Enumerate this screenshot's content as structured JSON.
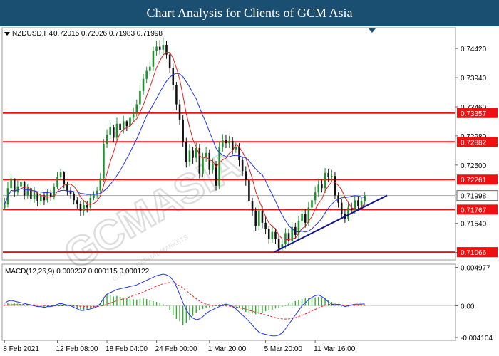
{
  "header": {
    "title": "Chart Analysis for Clients of GCM Asia"
  },
  "symbol_info": {
    "symbol": "NZDUSD,H4",
    "ohlc": "0.72015 0.72026 0.71983 0.71998"
  },
  "macd_info": {
    "label": "MACD(12,26,9) 0.000237 0.000115 0.000122"
  },
  "watermark": {
    "text": "GCMASIA",
    "subtext": "GLOBAL CAPITAL MARKETS"
  },
  "colors": {
    "resistance": "#ee1111",
    "trendline": "#111199",
    "ma_fast": "#dd2222",
    "ma_slow": "#2233ee",
    "bull": "#1d8f2c",
    "bear": "#111111",
    "current_price_bg": "#ffffff",
    "level_label_bg": "#ee1111",
    "macd_hist": "#33aa33",
    "macd_signal": "#ee2222",
    "macd_line": "#2233ee"
  },
  "chart_data": [
    {
      "type": "line",
      "title": "NZDUSD,H4",
      "ylim": [
        0.7095,
        0.7475
      ],
      "price_ticks": [
        "0.74420",
        "0.73940",
        "0.73460",
        "0.72980",
        "0.72500",
        "0.72020",
        "0.71540",
        "0.71060"
      ],
      "price_tick_values": [
        0.7442,
        0.7394,
        0.7346,
        0.7298,
        0.725,
        0.7202,
        0.7154,
        0.7106
      ],
      "x_labels": [
        "8 Feb 2021",
        "12 Feb 08:00",
        "18 Feb 04:00",
        "24 Feb 00:00",
        "1 Mar 20:00",
        "5 Mar 20:00",
        "11 Mar 16:00"
      ],
      "levels": [
        {
          "label": "0.73357",
          "value": 0.73357
        },
        {
          "label": "0.72882",
          "value": 0.72882
        },
        {
          "label": "0.72261",
          "value": 0.72261
        },
        {
          "label": "0.71767",
          "value": 0.71767
        },
        {
          "label": "0.71066",
          "value": 0.71066
        }
      ],
      "current_price": {
        "label": "0.71998",
        "value": 0.71998
      },
      "trendline": {
        "from": [
          0.0,
          0.7107
        ],
        "to": [
          1.0,
          0.72
        ]
      },
      "series": [
        {
          "close": [
            0.7185,
            0.7212,
            0.7228,
            0.7205,
            0.7215,
            0.7222,
            0.72,
            0.7212,
            0.7194,
            0.7205,
            0.719,
            0.72,
            0.7192,
            0.7204,
            0.7197,
            0.7214,
            0.723,
            0.7238,
            0.7219,
            0.7208,
            0.7203,
            0.7192,
            0.7186,
            0.7174,
            0.7184,
            0.718,
            0.7196,
            0.7201,
            0.7208,
            0.7228,
            0.7285,
            0.73,
            0.7312,
            0.7295,
            0.7318,
            0.7308,
            0.7322,
            0.7314,
            0.7328,
            0.7336,
            0.735,
            0.7372,
            0.7392,
            0.7405,
            0.7412,
            0.7438,
            0.7445,
            0.744,
            0.7448,
            0.7432,
            0.741,
            0.7382,
            0.735,
            0.7325,
            0.7288,
            0.7255,
            0.7274,
            0.7262,
            0.7278,
            0.7236,
            0.7262,
            0.727,
            0.7242,
            0.7252,
            0.7216,
            0.728,
            0.7292,
            0.7286,
            0.729,
            0.7276,
            0.728,
            0.7258,
            0.724,
            0.7225,
            0.719,
            0.7175,
            0.715,
            0.7175,
            0.7155,
            0.7145,
            0.7128,
            0.714,
            0.7128,
            0.7112,
            0.712,
            0.7138,
            0.7125,
            0.7148,
            0.7135,
            0.7158,
            0.717,
            0.7155,
            0.718,
            0.7192,
            0.7205,
            0.7218,
            0.7212,
            0.7237,
            0.723,
            0.7232,
            0.72,
            0.7188,
            0.717,
            0.7162,
            0.718,
            0.7176,
            0.7192,
            0.7182,
            0.719,
            0.72
          ],
          "name": "",
          "high": [
            0.7196,
            0.7222,
            0.7236,
            0.7226,
            0.7225,
            0.723,
            0.7224,
            0.7218,
            0.7214,
            0.7214,
            0.7205,
            0.7207,
            0.7205,
            0.721,
            0.7209,
            0.722,
            0.7239,
            0.7244,
            0.724,
            0.7223,
            0.7214,
            0.7207,
            0.7197,
            0.719,
            0.7192,
            0.719,
            0.7202,
            0.7207,
            0.7214,
            0.7237,
            0.7293,
            0.7309,
            0.732,
            0.7316,
            0.7328,
            0.7322,
            0.7331,
            0.7324,
            0.7334,
            0.7345,
            0.7358,
            0.7382,
            0.74,
            0.7412,
            0.742,
            0.7445,
            0.7455,
            0.7456,
            0.746,
            0.7455,
            0.7436,
            0.7417,
            0.7387,
            0.7358,
            0.7332,
            0.7295,
            0.7285,
            0.728,
            0.7287,
            0.7285,
            0.727,
            0.728,
            0.7276,
            0.7261,
            0.7257,
            0.7288,
            0.7301,
            0.73,
            0.7298,
            0.7296,
            0.7287,
            0.7286,
            0.7264,
            0.7248,
            0.7232,
            0.7196,
            0.718,
            0.7184,
            0.7183,
            0.7166,
            0.715,
            0.7151,
            0.7146,
            0.7135,
            0.7128,
            0.7146,
            0.7145,
            0.7156,
            0.7155,
            0.7166,
            0.718,
            0.7178,
            0.7189,
            0.72,
            0.7215,
            0.7228,
            0.7225,
            0.7245,
            0.7244,
            0.7242,
            0.7238,
            0.7205,
            0.7194,
            0.7178,
            0.7188,
            0.7188,
            0.72,
            0.7199,
            0.7197,
            0.7206
          ],
          "low": [
            0.7176,
            0.718,
            0.7205,
            0.7198,
            0.72,
            0.721,
            0.7193,
            0.7195,
            0.7186,
            0.7188,
            0.7182,
            0.7184,
            0.7184,
            0.7188,
            0.719,
            0.7193,
            0.721,
            0.7225,
            0.7212,
            0.72,
            0.7195,
            0.7185,
            0.7178,
            0.7166,
            0.7167,
            0.7172,
            0.7174,
            0.7192,
            0.7195,
            0.7202,
            0.7222,
            0.7278,
            0.7293,
            0.7287,
            0.7289,
            0.73,
            0.7302,
            0.7306,
            0.7308,
            0.7322,
            0.733,
            0.7344,
            0.7366,
            0.7385,
            0.7398,
            0.7405,
            0.743,
            0.7432,
            0.7432,
            0.7425,
            0.7402,
            0.7374,
            0.734,
            0.7316,
            0.728,
            0.7246,
            0.7248,
            0.7252,
            0.7255,
            0.7228,
            0.723,
            0.7255,
            0.7234,
            0.7236,
            0.7208,
            0.721,
            0.7272,
            0.7278,
            0.7278,
            0.7268,
            0.727,
            0.7248,
            0.7232,
            0.7216,
            0.7182,
            0.7166,
            0.7142,
            0.7143,
            0.7146,
            0.7136,
            0.712,
            0.7122,
            0.712,
            0.7104,
            0.7107,
            0.7112,
            0.7118,
            0.7118,
            0.7128,
            0.7128,
            0.715,
            0.7147,
            0.715,
            0.7174,
            0.7185,
            0.7198,
            0.7205,
            0.7204,
            0.7222,
            0.7222,
            0.7194,
            0.718,
            0.7162,
            0.7155,
            0.7158,
            0.717,
            0.717,
            0.7178,
            0.718,
            0.7183
          ]
        }
      ]
    },
    {
      "type": "line",
      "title": "MACD(12,26,9)",
      "ylim": [
        -0.00438,
        0.0053
      ],
      "ticks": [
        "0.004977",
        "0.00",
        "-0.004104"
      ],
      "tick_values": [
        0.004977,
        0.0,
        -0.004104
      ],
      "series": [
        {
          "name": "",
          "role": "hist",
          "values": [
            8e-05,
            0.00035,
            0.0004,
            0.0003,
            0.00028,
            0.00022,
            0.00015,
            0.0001,
            2e-05,
            -5e-05,
            -0.0001,
            -0.00012,
            -0.00018,
            -0.00014,
            -0.0001,
            -4e-05,
            0.00012,
            0.0003,
            0.00022,
            0.00012,
            5e-05,
            -0.0001,
            -0.0003,
            -0.0005,
            -0.00055,
            -0.00045,
            -0.00035,
            -0.00025,
            -8e-05,
            0.00035,
            0.0011,
            0.0015,
            0.0014,
            0.0012,
            0.00128,
            0.00115,
            0.00108,
            0.00098,
            0.0009,
            0.00085,
            0.0008,
            0.0009,
            0.00095,
            0.00088,
            0.0007,
            0.0006,
            0.0005,
            0.00038,
            0.00022,
            5e-05,
            -0.0006,
            -0.0012,
            -0.0017,
            -0.002,
            -0.0025,
            -0.0022,
            -0.00185,
            -0.0013,
            -0.0009,
            -0.0006,
            -0.0004,
            -0.0003,
            -0.0002,
            -0.0001,
            2e-05,
            0.00018,
            0.0002,
            0.00025,
            0.00015,
            5e-05,
            -0.0001,
            -0.0003,
            -0.0005,
            -0.0008,
            -0.00095,
            -0.001,
            -0.0011,
            -0.00105,
            -0.0009,
            -0.0007,
            -0.0006,
            -0.0005,
            -0.00035,
            -0.0003,
            -0.00015,
            0.0001,
            0.0003,
            0.00045,
            0.0006,
            0.00075,
            0.0009,
            0.00095,
            0.001,
            0.00105,
            0.0011,
            0.00115,
            0.00108,
            0.00095,
            0.0007,
            0.0005,
            0.0003,
            0.00015,
            -0.0001,
            -0.00015,
            -0.0001,
            0.0,
            5e-05,
            8e-05,
            0.0001,
            0.00012
          ]
        },
        {
          "name": "",
          "role": "signal",
          "values": [
            0.0001,
            0.00012,
            0.00014,
            0.00015,
            0.00016,
            0.00017,
            0.00017,
            0.00016,
            0.00014,
            0.00012,
            0.0001,
            8e-05,
            5e-05,
            3e-05,
            1e-05,
            -1e-05,
            -2e-05,
            -1e-05,
            1e-05,
            2e-05,
            2e-05,
            1e-05,
            -2e-05,
            -6e-05,
            -0.0001,
            -0.00012,
            -0.00013,
            -0.00012,
            -0.0001,
            -5e-05,
            5e-05,
            0.0002,
            0.00035,
            0.0005,
            0.00065,
            0.00078,
            0.00092,
            0.00105,
            0.00118,
            0.0013,
            0.00145,
            0.0016,
            0.00178,
            0.00195,
            0.00215,
            0.00235,
            0.00255,
            0.0027,
            0.00285,
            0.00295,
            0.003,
            0.00295,
            0.0028,
            0.00258,
            0.0023,
            0.00195,
            0.0016,
            0.00125,
            0.00092,
            0.00062,
            0.00038,
            0.00022,
            0.00012,
            6e-05,
            3e-05,
            1e-05,
            0.0,
            -2e-05,
            -5e-05,
            -0.0001,
            -0.00016,
            -0.00024,
            -0.00034,
            -0.00046,
            -0.00058,
            -0.0007,
            -0.00082,
            -0.00094,
            -0.00106,
            -0.00118,
            -0.0013,
            -0.00142,
            -0.00154,
            -0.00164,
            -0.0017,
            -0.00172,
            -0.0017,
            -0.00164,
            -0.00154,
            -0.0014,
            -0.00124,
            -0.00106,
            -0.00086,
            -0.00066,
            -0.00046,
            -0.00026,
            -8e-05,
            6e-05,
            0.00016,
            0.0002,
            0.0002,
            0.00017,
            0.00012,
            8e-05,
            6e-05,
            6e-05,
            8e-05,
            0.0001,
            0.00011,
            0.000115
          ]
        },
        {
          "name": "",
          "role": "macd",
          "values": [
            0.0003,
            0.0006,
            0.0007,
            0.0006,
            0.0005,
            0.0004,
            0.0003,
            0.0002,
            0.0001,
            0.0,
            -0.0001,
            -0.0001,
            -0.0002,
            -0.0001,
            -0.0001,
            0.0,
            0.0002,
            0.0003,
            0.0002,
            0.0001,
            0.0,
            -0.0002,
            -0.0004,
            -0.0006,
            -0.0006,
            -0.0005,
            -0.0004,
            -0.0003,
            -0.0001,
            0.0003,
            0.001,
            0.0015,
            0.0017,
            0.0019,
            0.0021,
            0.0022,
            0.0023,
            0.0024,
            0.0025,
            0.0026,
            0.0027,
            0.0029,
            0.0031,
            0.0033,
            0.0035,
            0.0037,
            0.0039,
            0.004,
            0.0041,
            0.004,
            0.0038,
            0.0033,
            0.0025,
            0.0015,
            0.0004,
            -0.0005,
            -0.0012,
            -0.0016,
            -0.0018,
            -0.0017,
            -0.0014,
            -0.001,
            -0.0007,
            -0.0005,
            -0.0003,
            -0.0001,
            0.0001,
            0.0002,
            0.0001,
            -0.0001,
            -0.0004,
            -0.0008,
            -0.0012,
            -0.0016,
            -0.002,
            -0.0025,
            -0.003,
            -0.0034,
            -0.0036,
            -0.0037,
            -0.0038,
            -0.0039,
            -0.0039,
            -0.0038,
            -0.0035,
            -0.003,
            -0.0024,
            -0.0018,
            -0.0012,
            -0.0006,
            0.0,
            0.0004,
            0.0008,
            0.0011,
            0.0013,
            0.0014,
            0.0012,
            0.0009,
            0.0005,
            0.0002,
            0.0001,
            0.0002,
            0.0001,
            -0.0001,
            0.0,
            0.0001,
            0.0002,
            0.0002,
            0.00022,
            0.000237
          ]
        }
      ]
    }
  ]
}
